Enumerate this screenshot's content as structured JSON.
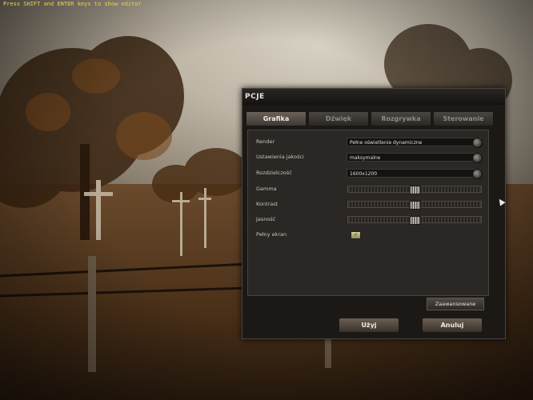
{
  "editor_hint": "Press SHIFT and ENTER keys to show editor",
  "dialog": {
    "title": "PCJE",
    "tabs": [
      {
        "label": "Grafika",
        "active": true
      },
      {
        "label": "Dźwięk",
        "active": false
      },
      {
        "label": "Rozgrywka",
        "active": false
      },
      {
        "label": "Sterowanie",
        "active": false
      }
    ],
    "settings": {
      "render": {
        "label": "Render",
        "value": "Pełne oświetlenie dynamiczne"
      },
      "quality": {
        "label": "Ustawienia jakości",
        "value": "maksymalne"
      },
      "resolution": {
        "label": "Rozdzielczość",
        "value": "1600x1200"
      },
      "gamma": {
        "label": "Gamma",
        "level": 0.5
      },
      "contrast": {
        "label": "Kontrast",
        "level": 0.5
      },
      "brightness": {
        "label": "Jasność",
        "level": 0.5
      },
      "fullscreen": {
        "label": "Pełny ekran",
        "checked": true
      }
    },
    "advanced_label": "Zaawansowane",
    "apply_label": "Użyj",
    "cancel_label": "Anuluj"
  },
  "colors": {
    "hint": "#e8d54a",
    "panel": "#2a2725",
    "text": "#c8c4bc"
  }
}
